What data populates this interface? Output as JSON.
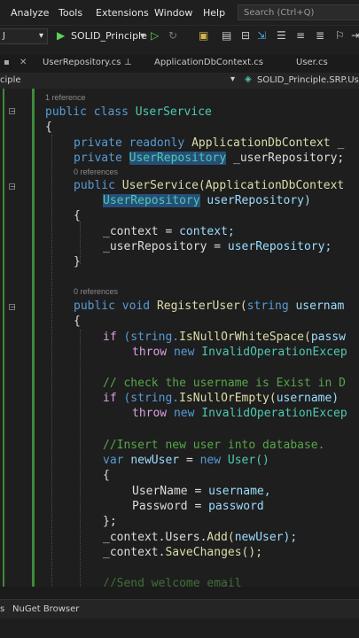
{
  "menu": [
    "Analyze",
    "Tools",
    "Extensions",
    "Window",
    "Help"
  ],
  "search_placeholder": "Search (Ctrl+Q)",
  "toolbar": {
    "config_value": "J",
    "startup_project": "SOLID_Principle"
  },
  "tabs": [
    "UserRepository.cs",
    "ApplicationDbContext.cs",
    "User.cs"
  ],
  "pathbar": {
    "left": "ciple",
    "right": "SOLID_Principle.SRP.User"
  },
  "refs": {
    "one": "1 reference",
    "zero": "0 references"
  },
  "code": {
    "l1": [
      "public",
      "class",
      "UserService"
    ],
    "l2": "{",
    "l3": [
      "private",
      "readonly",
      "ApplicationDbContext",
      "_"
    ],
    "l4": [
      "private",
      "UserRepository",
      "_userRepository;"
    ],
    "l5": [
      "public",
      "UserService(ApplicationDbContext"
    ],
    "l6": [
      "UserRepository",
      "userRepository)"
    ],
    "l7": "{",
    "l8": [
      "_context",
      "=",
      "context;"
    ],
    "l9": [
      "_userRepository",
      "=",
      "userRepository;"
    ],
    "l10": "}",
    "l11": [
      "public",
      "void",
      "RegisterUser(",
      "string",
      "usernam"
    ],
    "l12": "{",
    "l13": [
      "if",
      "(string.",
      "IsNullOrWhiteSpace(",
      "passw"
    ],
    "l14": [
      "throw",
      "new",
      "InvalidOperationExcep"
    ],
    "l15": "// check the username is Exist in D",
    "l16": [
      "if",
      "(string.",
      "IsNullOrEmpty(",
      "username)"
    ],
    "l17": [
      "throw",
      "new",
      "InvalidOperationExcep"
    ],
    "l18": "//Insert new user into database.",
    "l19": [
      "var",
      "newUser",
      "=",
      "new",
      "User()"
    ],
    "l20": "{",
    "l21": [
      "UserName",
      "=",
      "username,"
    ],
    "l22": [
      "Password",
      "=",
      "password"
    ],
    "l23": "};",
    "l24": [
      "_context.Users.",
      "Add(",
      "newUser);"
    ],
    "l25": [
      "_context.",
      "SaveChanges();"
    ],
    "l26": "//Send welcome email"
  },
  "bottom": {
    "left": "s",
    "nuget": "NuGet Browser"
  }
}
